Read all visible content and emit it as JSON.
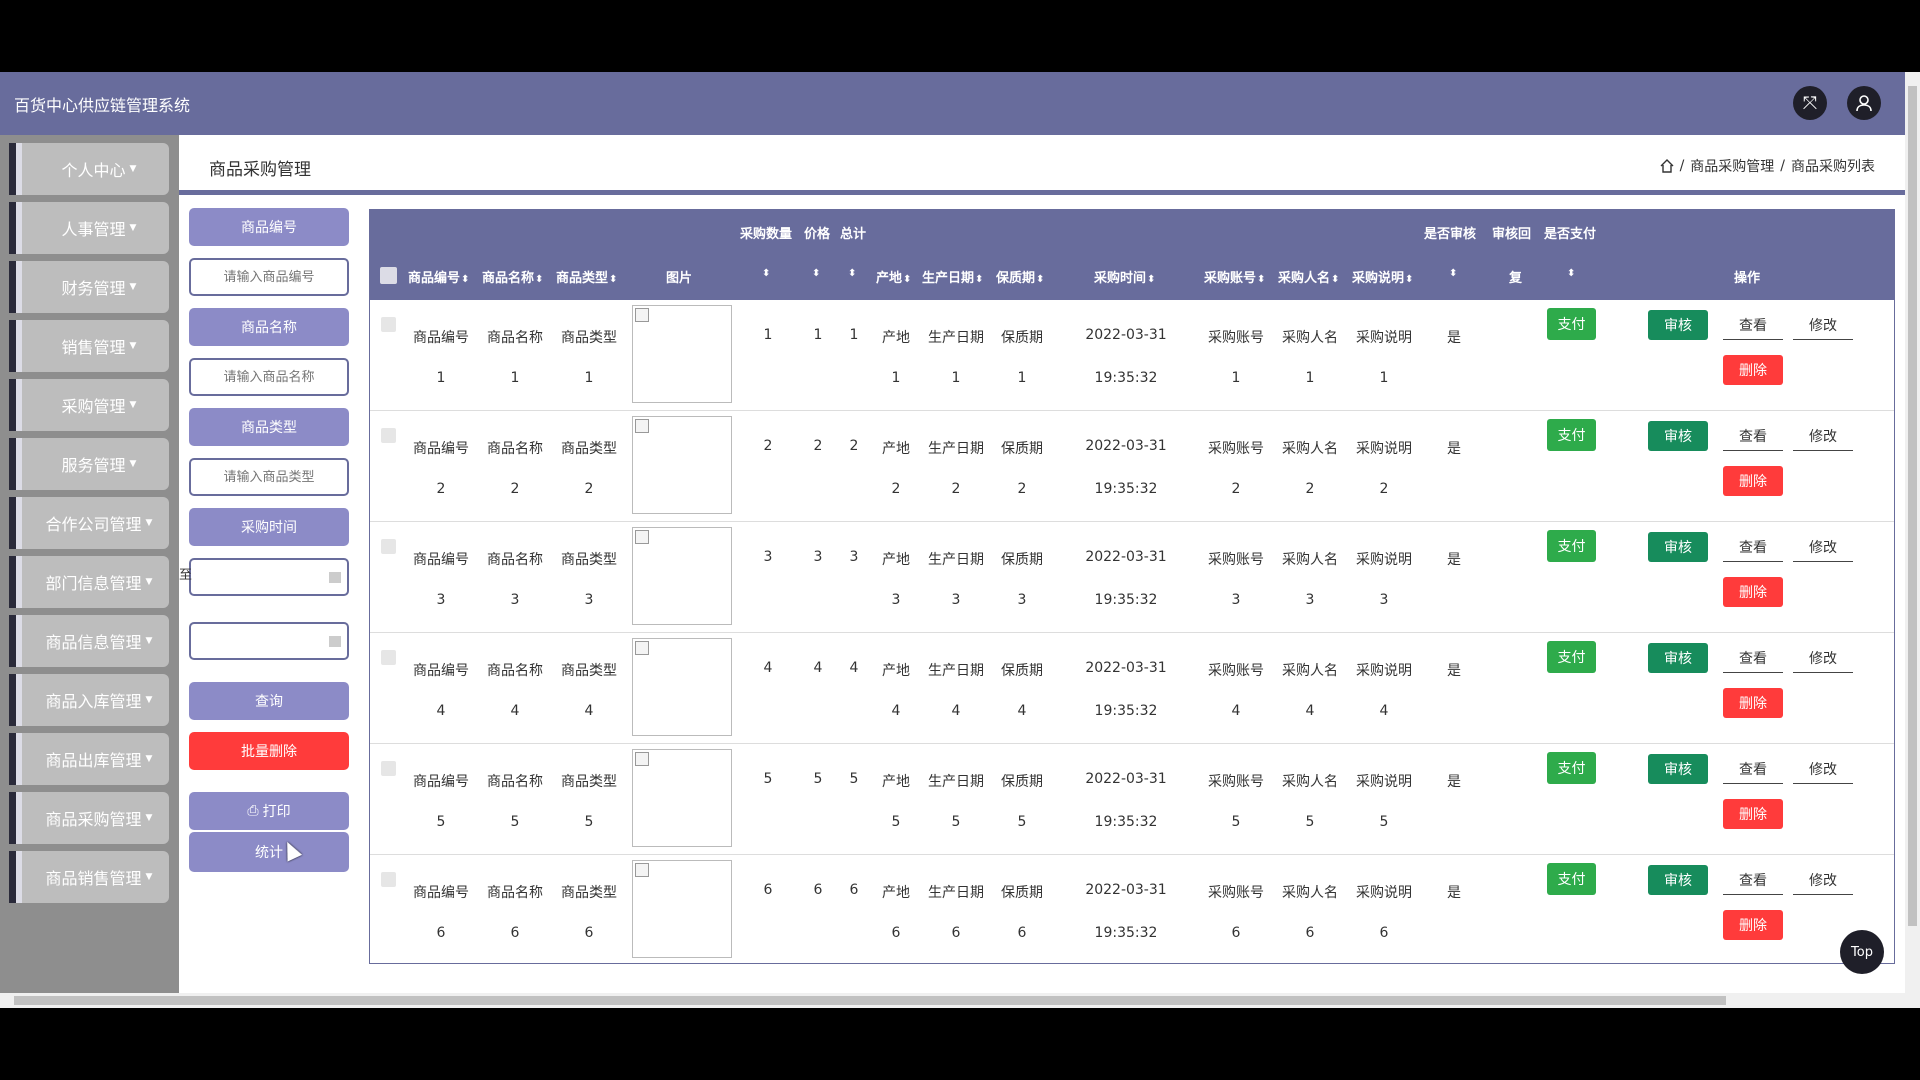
{
  "app": {
    "title": "百货中心供应链管理系统"
  },
  "topbar": {
    "fullscreen_icon": "expand-icon",
    "user_icon": "user-icon"
  },
  "sidebar": {
    "items": [
      {
        "label": "个人中心"
      },
      {
        "label": "人事管理"
      },
      {
        "label": "财务管理"
      },
      {
        "label": "销售管理"
      },
      {
        "label": "采购管理"
      },
      {
        "label": "服务管理"
      },
      {
        "label": "合作公司管理"
      },
      {
        "label": "部门信息管理"
      },
      {
        "label": "商品信息管理"
      },
      {
        "label": "商品入库管理"
      },
      {
        "label": "商品出库管理"
      },
      {
        "label": "商品采购管理"
      },
      {
        "label": "商品销售管理"
      }
    ]
  },
  "header": {
    "page_title": "商品采购管理",
    "breadcrumb": [
      "商品采购管理",
      "商品采购列表"
    ],
    "separator": "/"
  },
  "filters": {
    "code_label": "商品编号",
    "code_placeholder": "请输入商品编号",
    "name_label": "商品名称",
    "name_placeholder": "请输入商品名称",
    "type_label": "商品类型",
    "type_placeholder": "请输入商品类型",
    "time_label": "采购时间",
    "to_text": "至",
    "search_button": "查询",
    "batch_delete_button": "批量删除",
    "print_button": "打印",
    "stats_button": "统计"
  },
  "table": {
    "group_headers": {
      "qty": "采购数量",
      "price": "价格",
      "total": "总计",
      "audited": "是否审核",
      "audit_reply": "审核回",
      "paid": "是否支付"
    },
    "columns": {
      "code": "商品编号",
      "name": "商品名称",
      "type": "商品类型",
      "image": "图片",
      "origin": "产地",
      "prod_date": "生产日期",
      "shelf_life": "保质期",
      "time": "采购时间",
      "account": "采购账号",
      "buyer": "采购人名",
      "note": "采购说明",
      "reply_tail": "复",
      "actions": "操作"
    },
    "sort_glyph": "⬍",
    "action_labels": {
      "pay": "支付",
      "audit": "审核",
      "view": "查看",
      "edit": "修改",
      "delete": "删除"
    },
    "rows": [
      {
        "code": "商品编号",
        "code_n": "1",
        "name": "商品名称",
        "name_n": "1",
        "type": "商品类型",
        "type_n": "1",
        "qty": "1",
        "price": "1",
        "total": "1",
        "origin": "产地",
        "origin_n": "1",
        "prod_date": "生产日期",
        "prod_date_n": "1",
        "shelf": "保质期",
        "shelf_n": "1",
        "date": "2022-03-31",
        "time": "19:35:32",
        "account": "采购账号",
        "account_n": "1",
        "buyer": "采购人名",
        "buyer_n": "1",
        "note": "采购说明",
        "note_n": "1",
        "audited": "是"
      },
      {
        "code": "商品编号",
        "code_n": "2",
        "name": "商品名称",
        "name_n": "2",
        "type": "商品类型",
        "type_n": "2",
        "qty": "2",
        "price": "2",
        "total": "2",
        "origin": "产地",
        "origin_n": "2",
        "prod_date": "生产日期",
        "prod_date_n": "2",
        "shelf": "保质期",
        "shelf_n": "2",
        "date": "2022-03-31",
        "time": "19:35:32",
        "account": "采购账号",
        "account_n": "2",
        "buyer": "采购人名",
        "buyer_n": "2",
        "note": "采购说明",
        "note_n": "2",
        "audited": "是"
      },
      {
        "code": "商品编号",
        "code_n": "3",
        "name": "商品名称",
        "name_n": "3",
        "type": "商品类型",
        "type_n": "3",
        "qty": "3",
        "price": "3",
        "total": "3",
        "origin": "产地",
        "origin_n": "3",
        "prod_date": "生产日期",
        "prod_date_n": "3",
        "shelf": "保质期",
        "shelf_n": "3",
        "date": "2022-03-31",
        "time": "19:35:32",
        "account": "采购账号",
        "account_n": "3",
        "buyer": "采购人名",
        "buyer_n": "3",
        "note": "采购说明",
        "note_n": "3",
        "audited": "是"
      },
      {
        "code": "商品编号",
        "code_n": "4",
        "name": "商品名称",
        "name_n": "4",
        "type": "商品类型",
        "type_n": "4",
        "qty": "4",
        "price": "4",
        "total": "4",
        "origin": "产地",
        "origin_n": "4",
        "prod_date": "生产日期",
        "prod_date_n": "4",
        "shelf": "保质期",
        "shelf_n": "4",
        "date": "2022-03-31",
        "time": "19:35:32",
        "account": "采购账号",
        "account_n": "4",
        "buyer": "采购人名",
        "buyer_n": "4",
        "note": "采购说明",
        "note_n": "4",
        "audited": "是"
      },
      {
        "code": "商品编号",
        "code_n": "5",
        "name": "商品名称",
        "name_n": "5",
        "type": "商品类型",
        "type_n": "5",
        "qty": "5",
        "price": "5",
        "total": "5",
        "origin": "产地",
        "origin_n": "5",
        "prod_date": "生产日期",
        "prod_date_n": "5",
        "shelf": "保质期",
        "shelf_n": "5",
        "date": "2022-03-31",
        "time": "19:35:32",
        "account": "采购账号",
        "account_n": "5",
        "buyer": "采购人名",
        "buyer_n": "5",
        "note": "采购说明",
        "note_n": "5",
        "audited": "是"
      },
      {
        "code": "商品编号",
        "code_n": "6",
        "name": "商品名称",
        "name_n": "6",
        "type": "商品类型",
        "type_n": "6",
        "qty": "6",
        "price": "6",
        "total": "6",
        "origin": "产地",
        "origin_n": "6",
        "prod_date": "生产日期",
        "prod_date_n": "6",
        "shelf": "保质期",
        "shelf_n": "6",
        "date": "2022-03-31",
        "time": "19:35:32",
        "account": "采购账号",
        "account_n": "6",
        "buyer": "采购人名",
        "buyer_n": "6",
        "note": "采购说明",
        "note_n": "6",
        "audited": "是"
      }
    ]
  },
  "back_to_top": "Top",
  "colors": {
    "primary": "#686c9c",
    "accent_label": "#8c8bc7",
    "pay": "#2eab4b",
    "audit": "#178c5c",
    "danger": "#ff3b3b"
  }
}
